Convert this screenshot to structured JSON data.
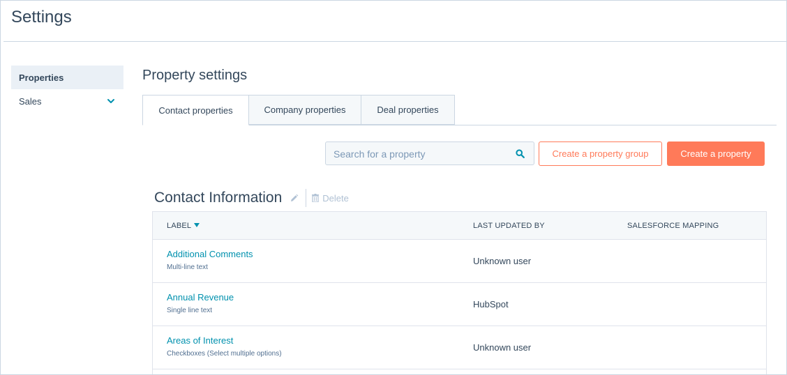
{
  "header": {
    "title": "Settings"
  },
  "sidebar": {
    "items": [
      {
        "label": "Properties"
      },
      {
        "label": "Sales"
      }
    ]
  },
  "main": {
    "title": "Property settings",
    "tabs": [
      {
        "label": "Contact properties"
      },
      {
        "label": "Company properties"
      },
      {
        "label": "Deal properties"
      }
    ],
    "search": {
      "placeholder": "Search for a property"
    },
    "buttons": {
      "create_group": "Create a property group",
      "create_property": "Create a property"
    },
    "group": {
      "title": "Contact Information",
      "delete_label": "Delete"
    },
    "table": {
      "columns": [
        "LABEL",
        "LAST UPDATED BY",
        "SALESFORCE MAPPING"
      ],
      "rows": [
        {
          "name": "Additional Comments",
          "type": "Multi-line text",
          "updated_by": "Unknown user"
        },
        {
          "name": "Annual Revenue",
          "type": "Single line text",
          "updated_by": "HubSpot"
        },
        {
          "name": "Areas of Interest",
          "type": "Checkboxes (Select multiple options)",
          "updated_by": "Unknown user"
        }
      ]
    }
  },
  "colors": {
    "accent": "#ff7a59",
    "link": "#0091ae",
    "text": "#33475b"
  }
}
